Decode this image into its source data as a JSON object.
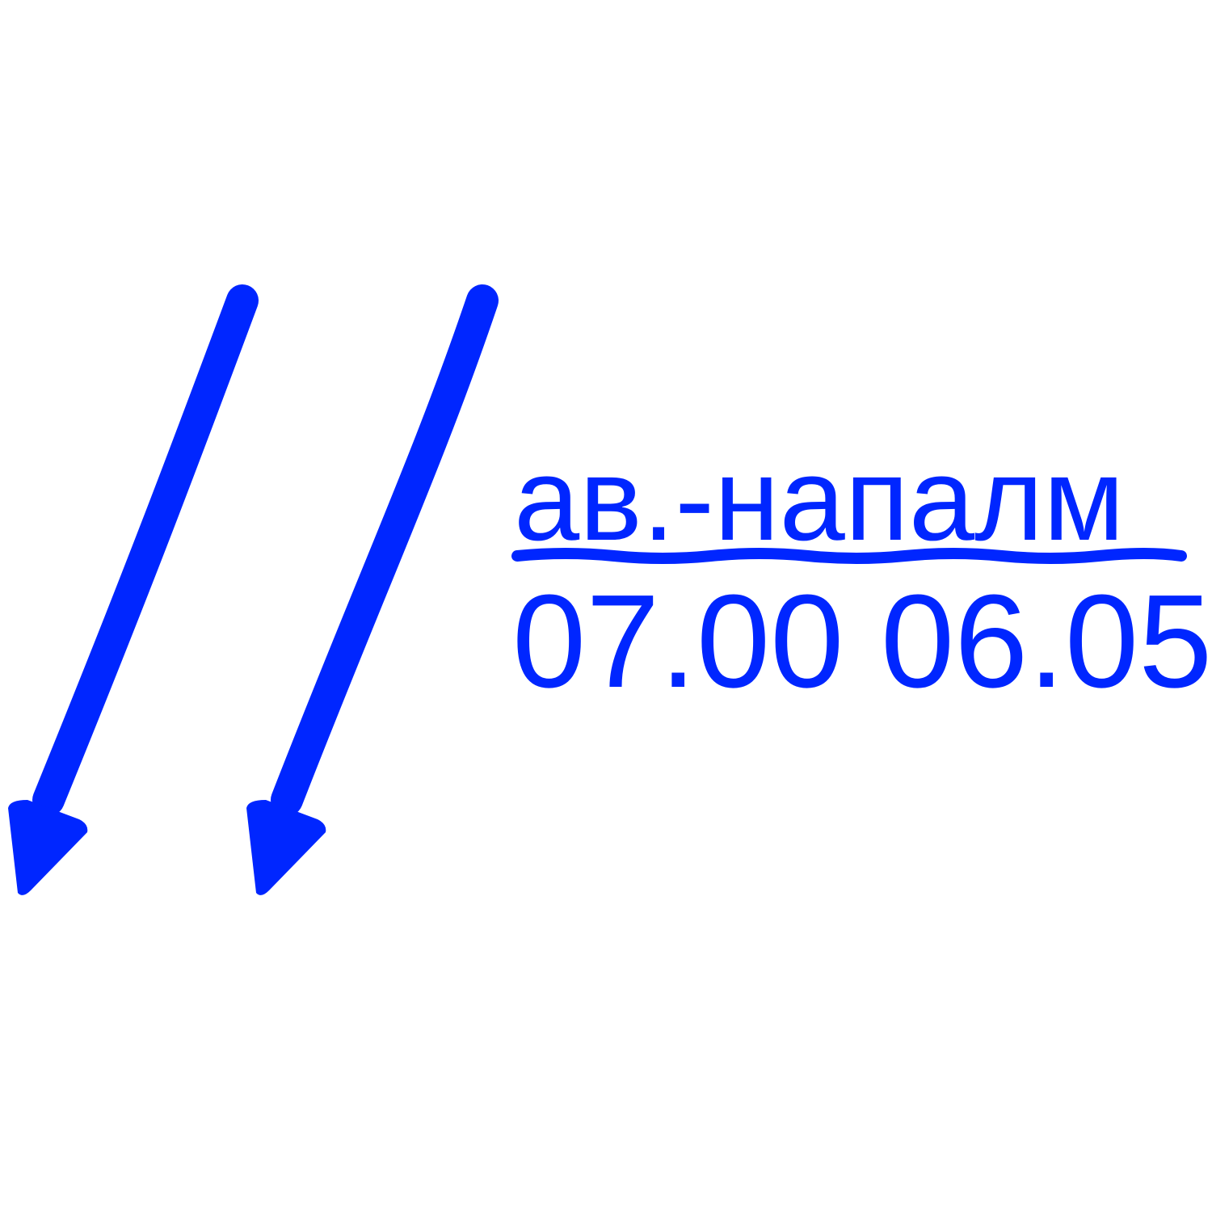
{
  "sign": {
    "label": "ав.-напалм",
    "times": "07.00 06.05",
    "color": "#0026ff",
    "arrow_count": 2,
    "arrow_icon": "arrow-down-left-icon"
  }
}
